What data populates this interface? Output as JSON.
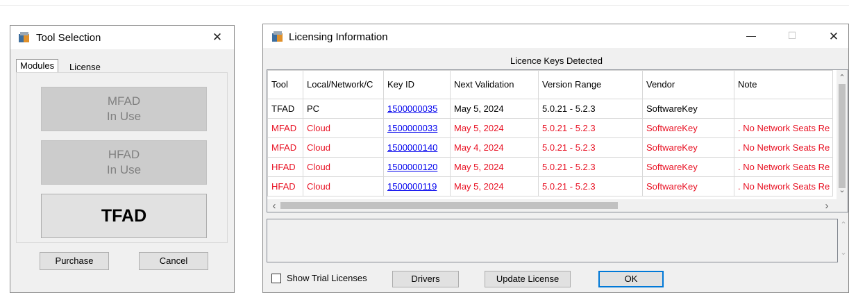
{
  "tool_selection": {
    "title": "Tool Selection",
    "close_glyph": "✕",
    "tabs": [
      {
        "label": "Modules",
        "active": true
      },
      {
        "label": "License",
        "active": false
      }
    ],
    "modules": [
      {
        "name": "MFAD",
        "status": "In Use",
        "enabled": false
      },
      {
        "name": "HFAD",
        "status": "In Use",
        "enabled": false
      },
      {
        "name": "TFAD",
        "status": "",
        "enabled": true
      }
    ],
    "purchase_label": "Purchase",
    "cancel_label": "Cancel"
  },
  "licensing": {
    "title": "Licensing Information",
    "minimize_glyph": "—",
    "maximize_glyph": "☐",
    "close_glyph": "✕",
    "caption": "Licence Keys Detected",
    "columns": [
      "Tool",
      "Local/Network/C",
      "Key ID",
      "Next Validation",
      "Version Range",
      "Vendor",
      "Note"
    ],
    "rows": [
      [
        "TFAD",
        "PC",
        "1500000035",
        "May 5, 2024",
        "5.0.21 - 5.2.3",
        "SoftwareKey",
        ""
      ],
      [
        "MFAD",
        "Cloud",
        "1500000033",
        "May 5, 2024",
        "5.0.21 - 5.2.3",
        "SoftwareKey",
        ". No Network Seats Re"
      ],
      [
        "MFAD",
        "Cloud",
        "1500000140",
        "May 4, 2024",
        "5.0.21 - 5.2.3",
        "SoftwareKey",
        ". No Network Seats Re"
      ],
      [
        "HFAD",
        "Cloud",
        "1500000120",
        "May 5, 2024",
        "5.0.21 - 5.2.3",
        "SoftwareKey",
        ". No Network Seats Re"
      ],
      [
        "HFAD",
        "Cloud",
        "1500000119",
        "May 5, 2024",
        "5.0.21 - 5.2.3",
        "SoftwareKey",
        ". No Network Seats Re"
      ]
    ],
    "show_trial_label": "Show Trial Licenses",
    "show_trial_checked": false,
    "drivers_label": "Drivers",
    "update_label": "Update License",
    "ok_label": "OK",
    "colors": {
      "highlight_text": "#e81123",
      "link": "#0000ee",
      "focus": "#0078d7"
    }
  },
  "icons": {
    "scroll_up": "⌃",
    "scroll_down": "⌄",
    "scroll_left": "‹",
    "scroll_right": "›"
  }
}
